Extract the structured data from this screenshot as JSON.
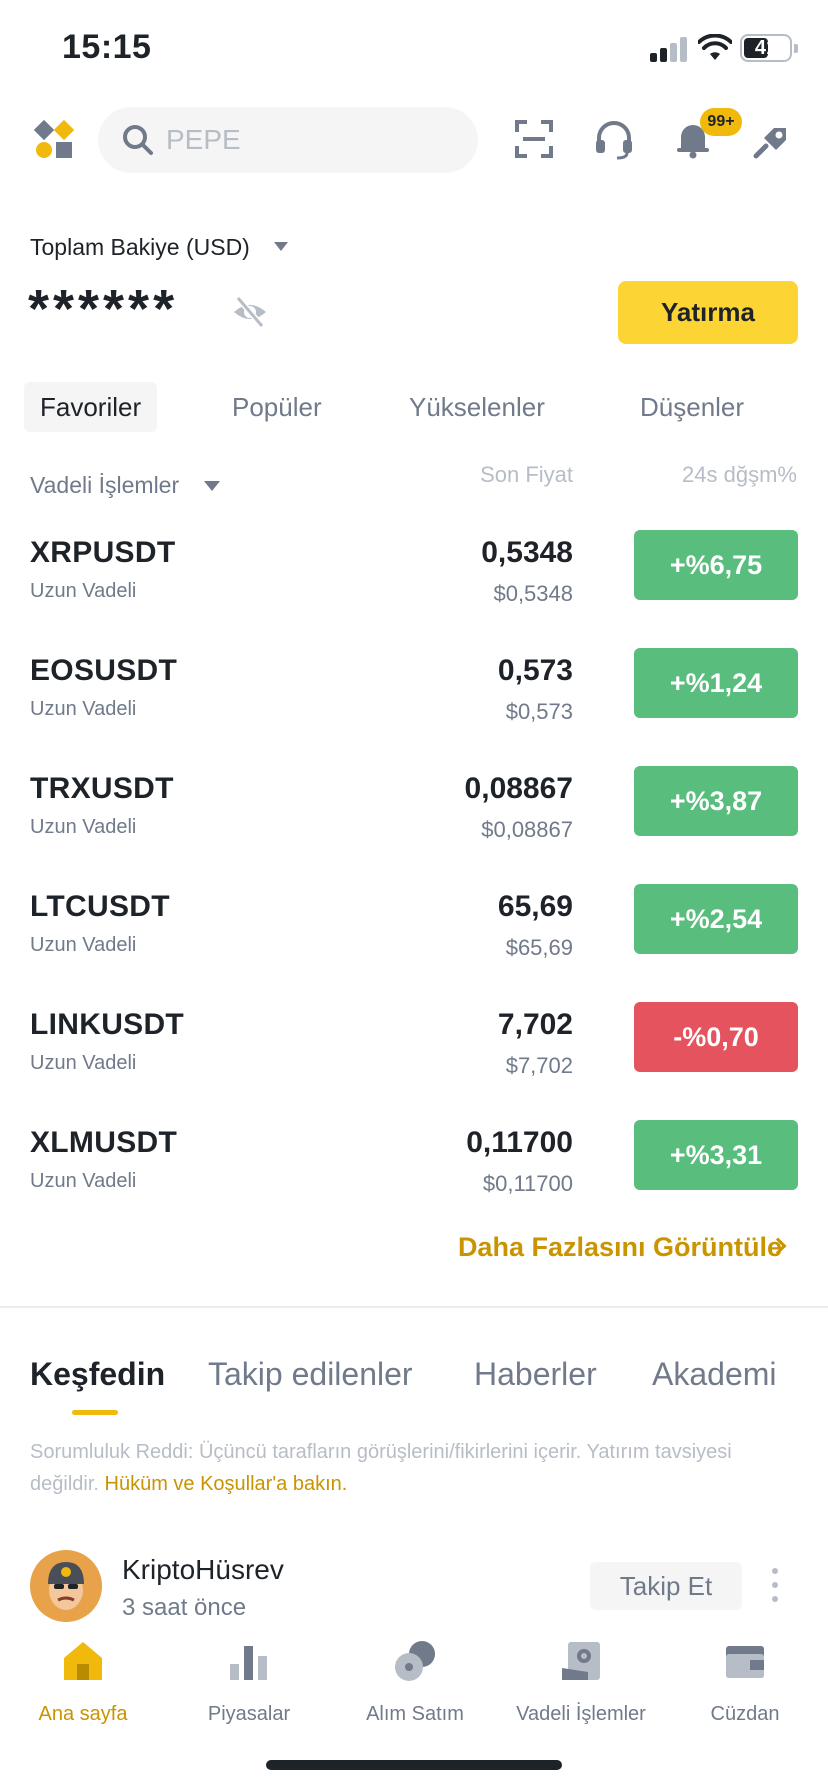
{
  "status_bar": {
    "time": "15:15",
    "battery": "41"
  },
  "top_bar": {
    "search_placeholder": "PEPE",
    "notification_badge": "99+",
    "icons": [
      "logo-icon",
      "search-icon",
      "scan-icon",
      "headset-icon",
      "bell-icon",
      "gift-icon"
    ]
  },
  "balance": {
    "label": "Toplam Bakiye (USD)",
    "value": "******",
    "deposit_label": "Yatırma"
  },
  "market_tabs": [
    {
      "label": "Favoriler",
      "active": true
    },
    {
      "label": "Popüler",
      "active": false
    },
    {
      "label": "Yükselenler",
      "active": false
    },
    {
      "label": "Düşenler",
      "active": false
    }
  ],
  "list_header": {
    "filter_label": "Vadeli İşlemler",
    "price_col": "Son Fiyat",
    "change_col": "24s dğşm%"
  },
  "rows": [
    {
      "symbol": "XRPUSDT",
      "sub": "Uzun Vadeli",
      "price": "0,5348",
      "usd": "$0,5348",
      "change": "+%6,75",
      "direction": "up"
    },
    {
      "symbol": "EOSUSDT",
      "sub": "Uzun Vadeli",
      "price": "0,573",
      "usd": "$0,573",
      "change": "+%1,24",
      "direction": "up"
    },
    {
      "symbol": "TRXUSDT",
      "sub": "Uzun Vadeli",
      "price": "0,08867",
      "usd": "$0,08867",
      "change": "+%3,87",
      "direction": "up"
    },
    {
      "symbol": "LTCUSDT",
      "sub": "Uzun Vadeli",
      "price": "65,69",
      "usd": "$65,69",
      "change": "+%2,54",
      "direction": "up"
    },
    {
      "symbol": "LINKUSDT",
      "sub": "Uzun Vadeli",
      "price": "7,702",
      "usd": "$7,702",
      "change": "-%0,70",
      "direction": "down"
    },
    {
      "symbol": "XLMUSDT",
      "sub": "Uzun Vadeli",
      "price": "0,11700",
      "usd": "$0,11700",
      "change": "+%3,31",
      "direction": "up"
    }
  ],
  "more_label": "Daha Fazlasını Görüntüle",
  "feed_tabs": [
    {
      "label": "Keşfedin",
      "active": true
    },
    {
      "label": "Takip edilenler",
      "active": false
    },
    {
      "label": "Haberler",
      "active": false
    },
    {
      "label": "Akademi",
      "active": false
    }
  ],
  "disclaimer": {
    "text": "Sorumluluk Reddi: Üçüncü tarafların görüşlerini/fikirlerini içerir. Yatırım tavsiyesi değildir. ",
    "link": "Hüküm ve Koşullar'a bakın."
  },
  "post": {
    "author": "KriptoHüsrev",
    "time_ago": "3 saat önce",
    "follow_label": "Takip Et"
  },
  "bottom_nav": [
    {
      "label": "Ana sayfa",
      "icon": "home-icon",
      "active": true
    },
    {
      "label": "Piyasalar",
      "icon": "markets-icon",
      "active": false
    },
    {
      "label": "Alım Satım",
      "icon": "trade-icon",
      "active": false
    },
    {
      "label": "Vadeli İşlemler",
      "icon": "futures-icon",
      "active": false
    },
    {
      "label": "Cüzdan",
      "icon": "wallet-icon",
      "active": false
    }
  ],
  "colors": {
    "up": "#58bd7d",
    "down": "#e5535e",
    "accent": "#fcd535",
    "link": "#c99400"
  }
}
